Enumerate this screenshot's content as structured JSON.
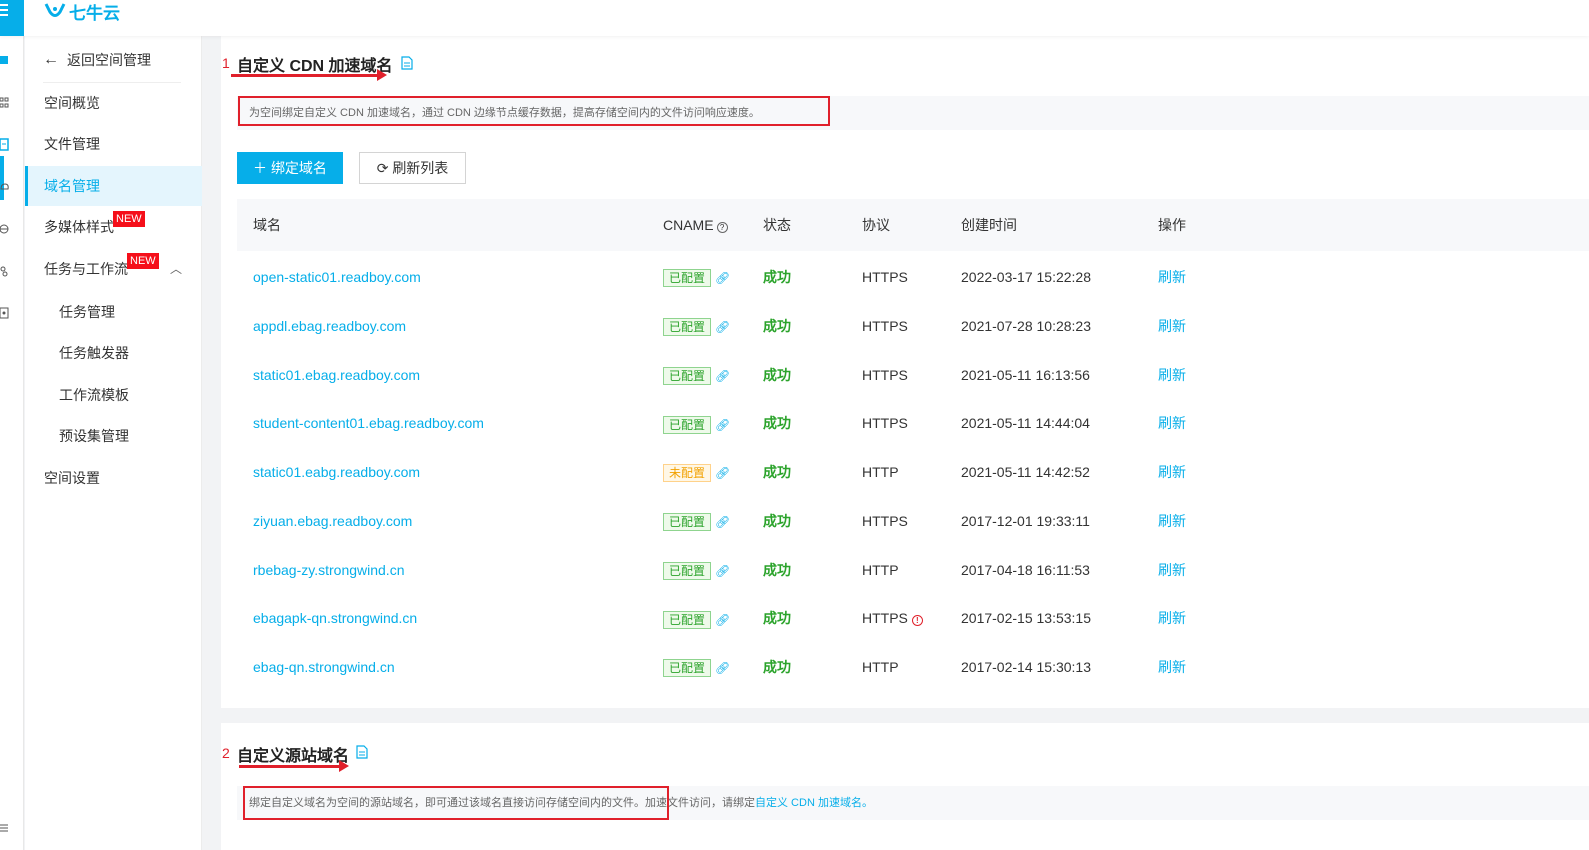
{
  "app": {
    "logo_text": "七牛云",
    "brand_color": "#06aee9"
  },
  "sidebar": {
    "back_label": "返回空间管理",
    "items": [
      {
        "label": "空间概览"
      },
      {
        "label": "文件管理"
      },
      {
        "label": "域名管理",
        "active": true
      },
      {
        "label": "多媒体样式",
        "badge": "NEW"
      },
      {
        "label": "任务与工作流",
        "badge": "NEW"
      },
      {
        "label": "任务管理"
      },
      {
        "label": "任务触发器"
      },
      {
        "label": "工作流模板"
      },
      {
        "label": "预设集管理"
      },
      {
        "label": "空间设置"
      }
    ]
  },
  "section1": {
    "number": "1",
    "title": "自定义 CDN 加速域名",
    "description": "为空间绑定自定义 CDN 加速域名，通过 CDN 边缘节点缓存数据，提高存储空间内的文件访问响应速度。",
    "bind_button": "绑定域名",
    "refresh_button": "刷新列表",
    "columns": {
      "domain": "域名",
      "cname": "CNAME",
      "status": "状态",
      "protocol": "协议",
      "created": "创建时间",
      "action": "操作"
    },
    "rows": [
      {
        "domain": "open-static01.readboy.com",
        "cname": "已配置",
        "cname_ok": true,
        "status": "成功",
        "protocol": "HTTPS",
        "warn": false,
        "created": "2022-03-17 15:22:28",
        "action": "刷新"
      },
      {
        "domain": "appdl.ebag.readboy.com",
        "cname": "已配置",
        "cname_ok": true,
        "status": "成功",
        "protocol": "HTTPS",
        "warn": false,
        "created": "2021-07-28 10:28:23",
        "action": "刷新"
      },
      {
        "domain": "static01.ebag.readboy.com",
        "cname": "已配置",
        "cname_ok": true,
        "status": "成功",
        "protocol": "HTTPS",
        "warn": false,
        "created": "2021-05-11 16:13:56",
        "action": "刷新"
      },
      {
        "domain": "student-content01.ebag.readboy.com",
        "cname": "已配置",
        "cname_ok": true,
        "status": "成功",
        "protocol": "HTTPS",
        "warn": false,
        "created": "2021-05-11 14:44:04",
        "action": "刷新"
      },
      {
        "domain": "static01.eabg.readboy.com",
        "cname": "未配置",
        "cname_ok": false,
        "status": "成功",
        "protocol": "HTTP",
        "warn": false,
        "created": "2021-05-11 14:42:52",
        "action": "刷新"
      },
      {
        "domain": "ziyuan.ebag.readboy.com",
        "cname": "已配置",
        "cname_ok": true,
        "status": "成功",
        "protocol": "HTTPS",
        "warn": false,
        "created": "2017-12-01 19:33:11",
        "action": "刷新"
      },
      {
        "domain": "rbebag-zy.strongwind.cn",
        "cname": "已配置",
        "cname_ok": true,
        "status": "成功",
        "protocol": "HTTP",
        "warn": false,
        "created": "2017-04-18 16:11:53",
        "action": "刷新"
      },
      {
        "domain": "ebagapk-qn.strongwind.cn",
        "cname": "已配置",
        "cname_ok": true,
        "status": "成功",
        "protocol": "HTTPS",
        "warn": true,
        "created": "2017-02-15 13:53:15",
        "action": "刷新"
      },
      {
        "domain": "ebag-qn.strongwind.cn",
        "cname": "已配置",
        "cname_ok": true,
        "status": "成功",
        "protocol": "HTTP",
        "warn": false,
        "created": "2017-02-14 15:30:13",
        "action": "刷新"
      }
    ]
  },
  "section2": {
    "number": "2",
    "title": "自定义源站域名",
    "description_main": "绑定自定义域名为空间的源站域名，即可通过该域名直接访问存储空间内的文件。",
    "description_tail": "加速文件访问，请绑定",
    "description_link": "自定义 CDN 加速域名。"
  }
}
